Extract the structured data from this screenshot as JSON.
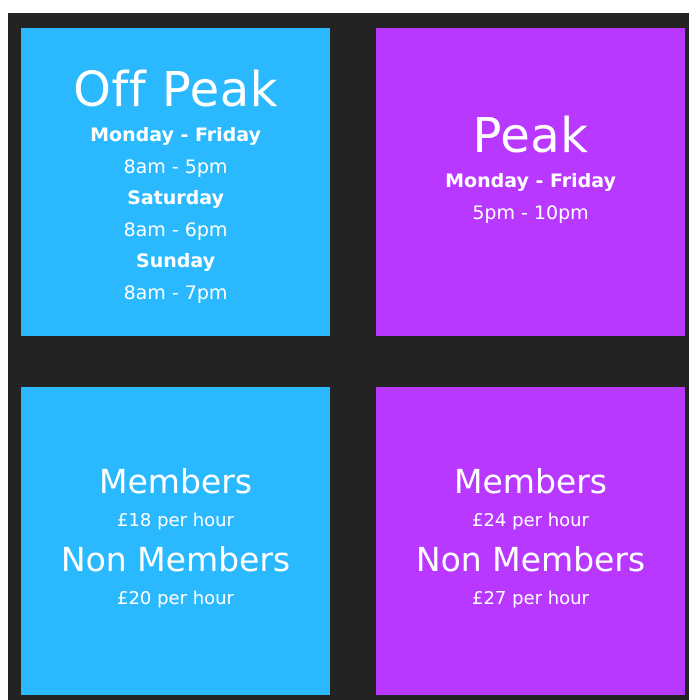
{
  "off_peak": {
    "title": "Off Peak",
    "schedule": [
      {
        "days": "Monday - Friday",
        "hours": "8am - 5pm"
      },
      {
        "days": "Saturday",
        "hours": "8am - 6pm"
      },
      {
        "days": "Sunday",
        "hours": "8am - 7pm"
      }
    ]
  },
  "peak": {
    "title": "Peak",
    "schedule": [
      {
        "days": "Monday - Friday",
        "hours": "5pm - 10pm"
      }
    ]
  },
  "off_peak_prices": {
    "members_label": "Members",
    "members_price": "£18 per hour",
    "non_members_label": "Non Members",
    "non_members_price": "£20 per hour"
  },
  "peak_prices": {
    "members_label": "Members",
    "members_price": "£24 per hour",
    "non_members_label": "Non Members",
    "non_members_price": "£27 per hour"
  },
  "colors": {
    "off_peak": "#2ab9ff",
    "peak": "#b838ff",
    "background": "#232323"
  }
}
